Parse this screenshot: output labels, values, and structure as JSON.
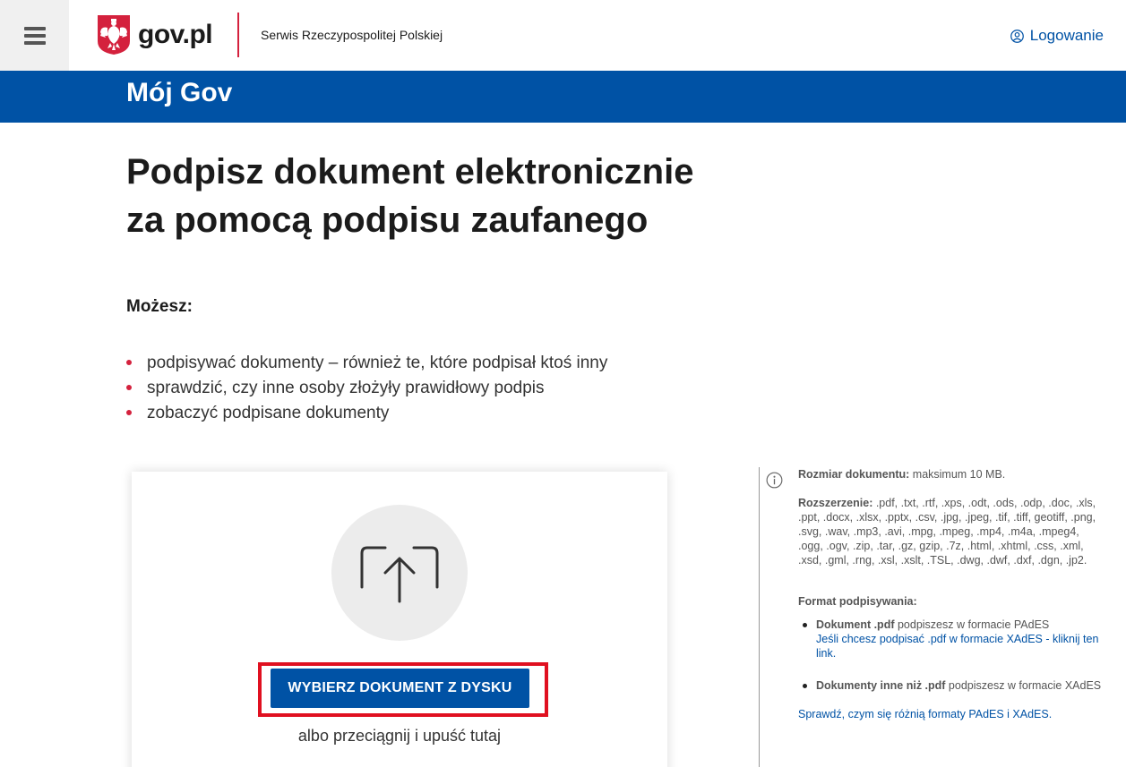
{
  "header": {
    "logo_text": "gov.pl",
    "subtitle": "Serwis Rzeczypospolitej Polskiej",
    "login_label": "Logowanie"
  },
  "band": {
    "title": "Mój Gov"
  },
  "main": {
    "title_line1": "Podpisz dokument elektronicznie",
    "title_line2": "za pomocą podpisu zaufanego",
    "can_label": "Możesz:",
    "features": [
      "podpisywać dokumenty – również te, które podpisał ktoś inny",
      "sprawdzić, czy inne osoby złożyły prawidłowy podpis",
      "zobaczyć podpisane dokumenty"
    ]
  },
  "upload": {
    "button_label": "WYBIERZ DOKUMENT Z DYSKU",
    "drag_hint": "albo przeciągnij i upuść tutaj"
  },
  "info": {
    "size_label": "Rozmiar dokumentu:",
    "size_value": " maksimum 10 MB.",
    "ext_label": "Rozszerzenie:",
    "ext_value": " .pdf, .txt, .rtf, .xps, .odt, .ods, .odp, .doc, .xls, .ppt, .docx, .xlsx, .pptx, .csv, .jpg, .jpeg, .tif, .tiff, geotiff, .png, .svg, .wav, .mp3, .avi, .mpg, .mpeg, .mp4, .m4a, .mpeg4, .ogg, .ogv, .zip, .tar, .gz, gzip, .7z, .html, .xhtml, .css, .xml, .xsd, .gml, .rng, .xsl, .xslt, .TSL, .dwg, .dwf, .dxf, .dgn, .jp2.",
    "format_label": "Format podpisywania:",
    "pdf_bold": "Dokument .pdf",
    "pdf_text": " podpiszesz w formacie PAdES",
    "pdf_link": "Jeśli chcesz podpisać .pdf w formacie XAdES - kliknij ten link.",
    "other_bold": "Dokumenty inne niż .pdf",
    "other_text": " podpiszesz w formacie XAdES",
    "compare_link": "Sprawdź, czym się różnią formaty PAdES i XAdES."
  },
  "colors": {
    "brand_blue": "#0052a5",
    "accent_red": "#d4213d",
    "highlight_red": "#e01020"
  }
}
